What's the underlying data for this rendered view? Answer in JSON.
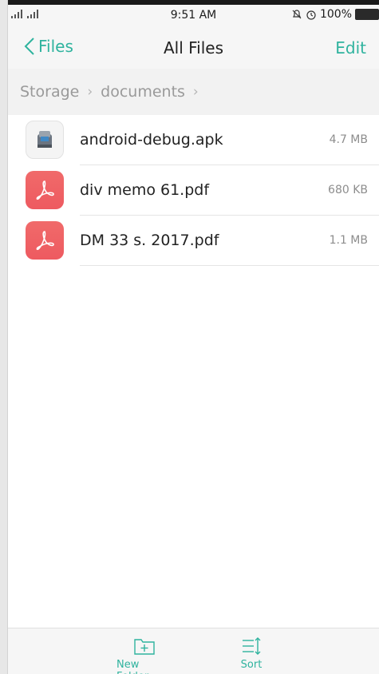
{
  "status_bar": {
    "time": "9:51 AM",
    "battery": "100%"
  },
  "nav": {
    "back_label": "Files",
    "title": "All Files",
    "edit_label": "Edit"
  },
  "breadcrumb": {
    "items": [
      "Storage",
      "documents"
    ]
  },
  "files": [
    {
      "name": "android-debug.apk",
      "size": "4.7 MB",
      "icon": "apk-icon"
    },
    {
      "name": "div memo 61.pdf",
      "size": "680 KB",
      "icon": "pdf-icon"
    },
    {
      "name": "DM 33 s.  2017.pdf",
      "size": "1.1 MB",
      "icon": "pdf-icon"
    }
  ],
  "toolbar": {
    "new_folder_label": "New Folder",
    "sort_label": "Sort"
  },
  "colors": {
    "accent": "#2fb39e",
    "pdf_red": "#ee5a60"
  }
}
